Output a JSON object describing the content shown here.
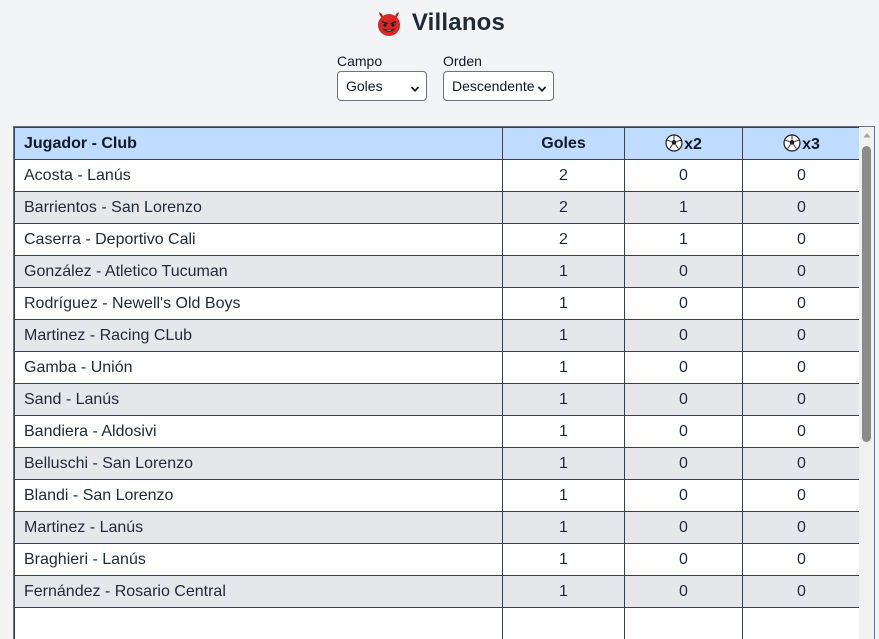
{
  "header": {
    "title": "Villanos",
    "icon": "devil-icon"
  },
  "controls": {
    "campo": {
      "label": "Campo",
      "value": "Goles"
    },
    "orden": {
      "label": "Orden",
      "value": "Descendente"
    }
  },
  "table": {
    "columns": [
      {
        "label": "Jugador - Club",
        "icon": ""
      },
      {
        "label": "Goles",
        "icon": ""
      },
      {
        "label": "x2",
        "icon": "soccer-ball-icon"
      },
      {
        "label": "x3",
        "icon": "soccer-ball-icon"
      }
    ],
    "rows": [
      {
        "player": "Acosta - Lanús",
        "goles": "2",
        "x2": "0",
        "x3": "0"
      },
      {
        "player": "Barrientos - San Lorenzo",
        "goles": "2",
        "x2": "1",
        "x3": "0"
      },
      {
        "player": "Caserra - Deportivo Cali",
        "goles": "2",
        "x2": "1",
        "x3": "0"
      },
      {
        "player": "González - Atletico Tucuman",
        "goles": "1",
        "x2": "0",
        "x3": "0"
      },
      {
        "player": "Rodríguez - Newell's Old Boys",
        "goles": "1",
        "x2": "0",
        "x3": "0"
      },
      {
        "player": "Martinez - Racing CLub",
        "goles": "1",
        "x2": "0",
        "x3": "0"
      },
      {
        "player": "Gamba - Unión",
        "goles": "1",
        "x2": "0",
        "x3": "0"
      },
      {
        "player": "Sand - Lanús",
        "goles": "1",
        "x2": "0",
        "x3": "0"
      },
      {
        "player": "Bandiera - Aldosivi",
        "goles": "1",
        "x2": "0",
        "x3": "0"
      },
      {
        "player": "Belluschi - San Lorenzo",
        "goles": "1",
        "x2": "0",
        "x3": "0"
      },
      {
        "player": "Blandi - San Lorenzo",
        "goles": "1",
        "x2": "0",
        "x3": "0"
      },
      {
        "player": "Martinez - Lanús",
        "goles": "1",
        "x2": "0",
        "x3": "0"
      },
      {
        "player": "Braghieri - Lanús",
        "goles": "1",
        "x2": "0",
        "x3": "0"
      },
      {
        "player": "Fernández - Rosario Central",
        "goles": "1",
        "x2": "0",
        "x3": "0"
      },
      {
        "player": "",
        "goles": "",
        "x2": "",
        "x3": ""
      }
    ]
  },
  "colors": {
    "header_bg": "#bfdbfe",
    "row_alt": "#e5e7eb",
    "page_bg": "#f3f4f6",
    "devil": "#dc2626"
  }
}
